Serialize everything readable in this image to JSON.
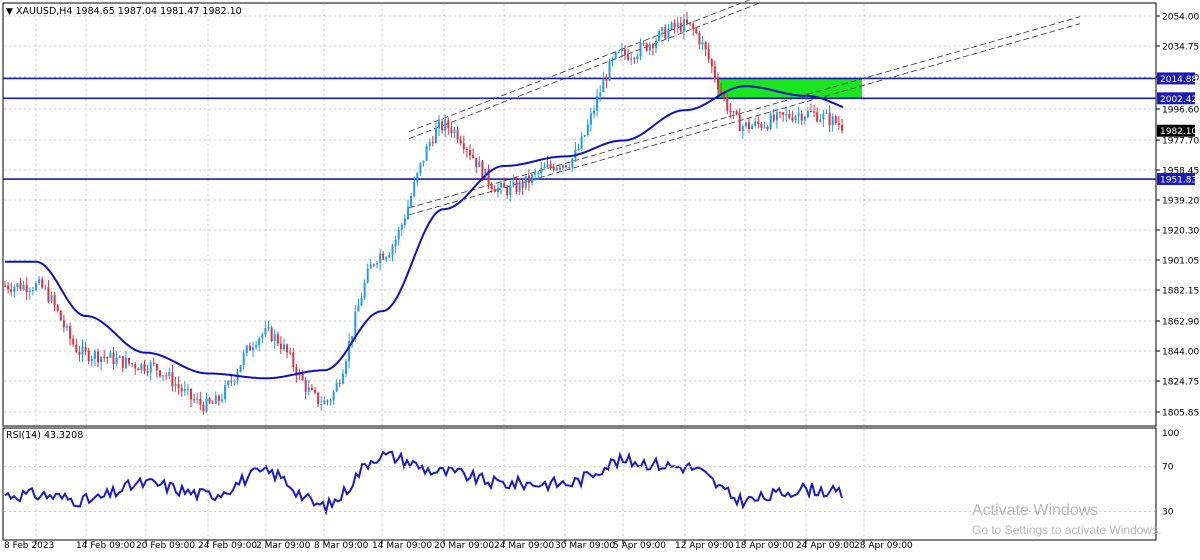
{
  "window": {
    "header_text": "XAUUSD,H4  1984.65 1987.04 1981.47 1982.10",
    "rsi_label": "RSI(14) 43.3208"
  },
  "watermark": {
    "title": "Activate Windows",
    "subtitle": "Go to Settings to activate Windows."
  },
  "colors": {
    "bull": "#1e9bf0",
    "bear": "#e0303a",
    "ma": "#1010c8",
    "hline": "#1a1ab8",
    "zone": "#19e61e",
    "rsi": "#1a1acc",
    "grid": "#c8c8c8",
    "channel": "#333333"
  },
  "chart_data": [
    {
      "type": "line",
      "title": "XAUUSD,H4",
      "symbol": "XAUUSD",
      "timeframe": "H4",
      "ohlc_last": {
        "open": 1984.65,
        "high": 1987.04,
        "low": 1981.47,
        "close": 1982.1
      },
      "current_price": "1982.10",
      "ylim": [
        1796.5,
        2063.5
      ],
      "yticks": [
        "2054.00",
        "2034.75",
        "2015.00",
        "1996.60",
        "1977.70",
        "1958.45",
        "1939.20",
        "1920.30",
        "1901.05",
        "1882.15",
        "1862.90",
        "1844.00",
        "1824.75",
        "1805.85"
      ],
      "xticks": [
        "8 Feb 2023",
        "14 Feb 09:00",
        "20 Feb 09:00",
        "24 Feb 09:00",
        "2 Mar 09:00",
        "8 Mar 09:00",
        "14 Mar 09:00",
        "20 Mar 09:00",
        "24 Mar 09:00",
        "30 Mar 09:00",
        "5 Apr 09:00",
        "12 Apr 09:00",
        "18 Apr 09:00",
        "24 Apr 09:00",
        "28 Apr 09:00"
      ],
      "horizontal_levels": [
        "2014.88",
        "2002.42",
        "1951.83"
      ],
      "supply_zone": {
        "from": "18 Apr",
        "to": "28 Apr",
        "low": 2002.42,
        "high": 2014.88,
        "color": "#19e61e"
      },
      "moving_average": {
        "x": [
          "8 Feb",
          "14 Feb",
          "20 Feb",
          "24 Feb",
          "2 Mar",
          "8 Mar",
          "14 Mar",
          "20 Mar",
          "24 Mar",
          "30 Mar",
          "5 Apr",
          "12 Apr",
          "18 Apr",
          "24 Apr",
          "28 Apr"
        ],
        "y": [
          1900,
          1866,
          1843,
          1830,
          1827,
          1832,
          1869,
          1933,
          1960,
          1966,
          1976,
          1995,
          2010,
          2004,
          1994
        ]
      },
      "close_path": {
        "x": [
          "8 Feb",
          "14 Feb",
          "20 Feb",
          "24 Feb",
          "2 Mar",
          "8 Mar",
          "14 Mar",
          "20 Mar",
          "24 Mar",
          "30 Mar",
          "5 Apr",
          "12 Apr",
          "18 Apr",
          "24 Apr",
          "28 Apr"
        ],
        "y": [
          1885,
          1842,
          1835,
          1810,
          1855,
          1812,
          1905,
          1985,
          1945,
          1962,
          2030,
          2048,
          1985,
          1993,
          1982
        ]
      },
      "channel": {
        "upper": {
          "from": [
            "20 Mar",
            1990
          ],
          "to": [
            "18 Apr",
            2063
          ]
        },
        "lower": {
          "from": [
            "20 Mar",
            1940
          ],
          "to": [
            "28 Apr",
            2015
          ]
        }
      }
    },
    {
      "type": "line",
      "title": "RSI(14) 43.3208",
      "indicator": "RSI(14)",
      "value": 43.3208,
      "ylim": [
        10,
        100
      ],
      "yticks": [
        "100",
        "70",
        "30"
      ],
      "x": [
        "8 Feb",
        "14 Feb",
        "20 Feb",
        "24 Feb",
        "2 Mar",
        "8 Mar",
        "14 Mar",
        "20 Mar",
        "24 Mar",
        "30 Mar",
        "5 Apr",
        "12 Apr",
        "18 Apr",
        "24 Apr",
        "28 Apr"
      ],
      "y": [
        45,
        40,
        55,
        45,
        65,
        35,
        80,
        65,
        55,
        55,
        75,
        70,
        40,
        50,
        43
      ]
    }
  ]
}
